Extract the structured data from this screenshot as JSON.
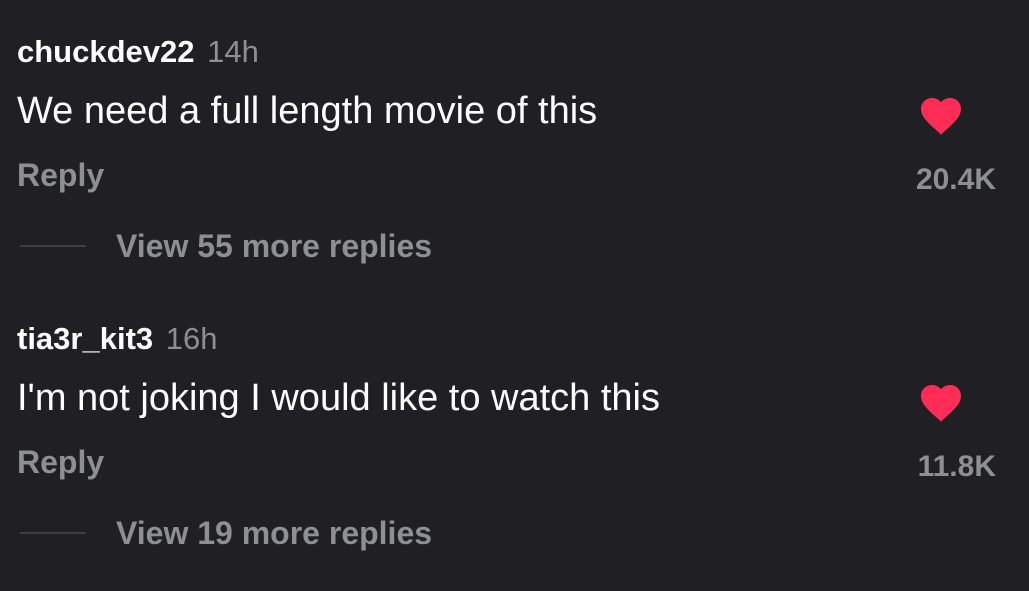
{
  "accent": {
    "heart": "#ff2d55",
    "muted": "#8e8e95",
    "background": "#1f1f24"
  },
  "comments": [
    {
      "username": "chuckdev22",
      "time": "14h",
      "text": "We need a full length movie of this",
      "reply_label": "Reply",
      "likes": "20.4K",
      "like_icon": "heart-icon",
      "more_replies": "View 55 more replies"
    },
    {
      "username": "tia3r_kit3",
      "time": "16h",
      "text": "I'm not joking I would like to watch this",
      "reply_label": "Reply",
      "likes": "11.8K",
      "like_icon": "heart-icon",
      "more_replies": "View 19 more replies"
    }
  ]
}
